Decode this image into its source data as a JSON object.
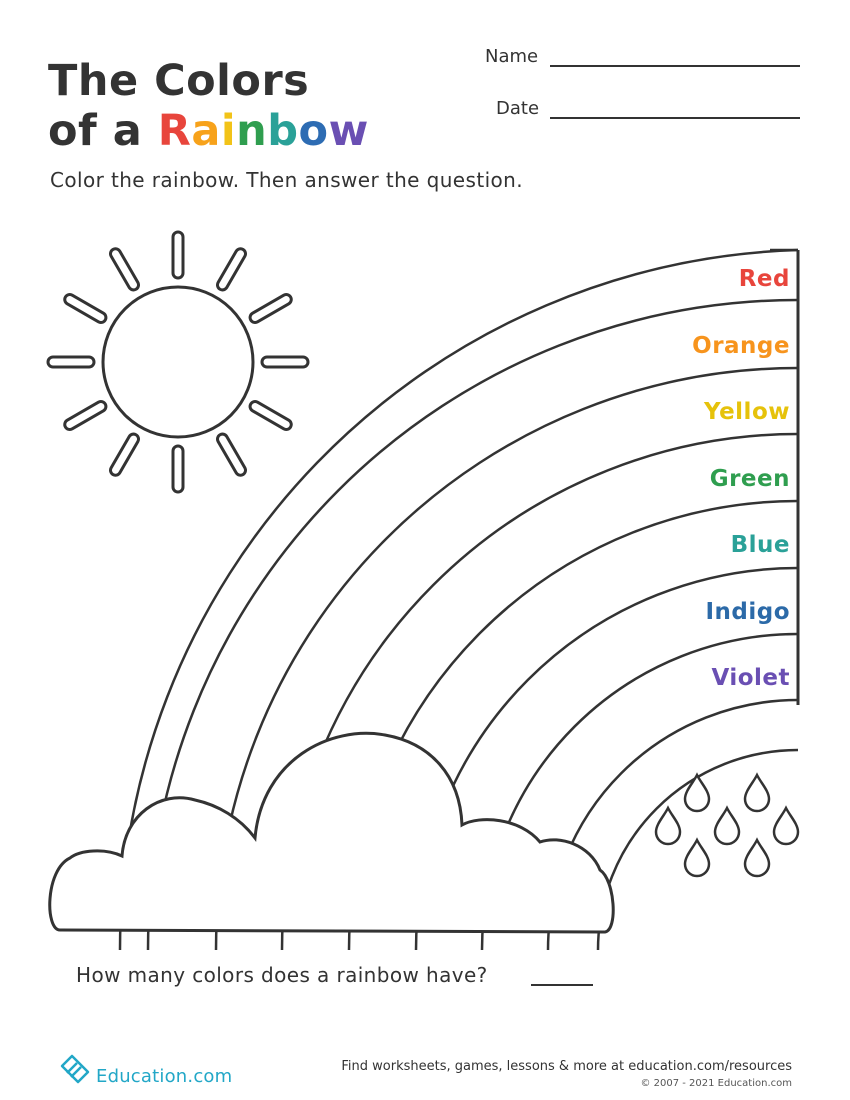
{
  "title": {
    "line1": "The Colors",
    "line2_prefix": "of a ",
    "rainbow_letters": [
      {
        "char": "R",
        "color": "#e8453c"
      },
      {
        "char": "a",
        "color": "#f7a21b"
      },
      {
        "char": "i",
        "color": "#f2c318"
      },
      {
        "char": "n",
        "color": "#2f9e4f"
      },
      {
        "char": "b",
        "color": "#2aa198"
      },
      {
        "char": "o",
        "color": "#2d6cb3"
      },
      {
        "char": "w",
        "color": "#6a4fb3"
      }
    ]
  },
  "fields": {
    "name_label": "Name",
    "date_label": "Date"
  },
  "instructions": "Color the rainbow. Then answer the question.",
  "bands": [
    {
      "label": "Red",
      "color": "#e8453c"
    },
    {
      "label": "Orange",
      "color": "#f7941d"
    },
    {
      "label": "Yellow",
      "color": "#e6c20b"
    },
    {
      "label": "Green",
      "color": "#2f9e4f"
    },
    {
      "label": "Blue",
      "color": "#2aa198"
    },
    {
      "label": "Indigo",
      "color": "#2c6aa8"
    },
    {
      "label": "Violet",
      "color": "#6a4fb3"
    }
  ],
  "question": "How many colors does a rainbow have?",
  "footer": {
    "brand": "Education.com",
    "brand_color": "#22a7c7",
    "tagline": "Find worksheets, games, lessons & more at education.com/resources",
    "copyright": "© 2007 - 2021 Education.com"
  },
  "icons": [
    "sun-icon",
    "cloud-icon",
    "raindrops-icon",
    "education-logo-icon"
  ]
}
